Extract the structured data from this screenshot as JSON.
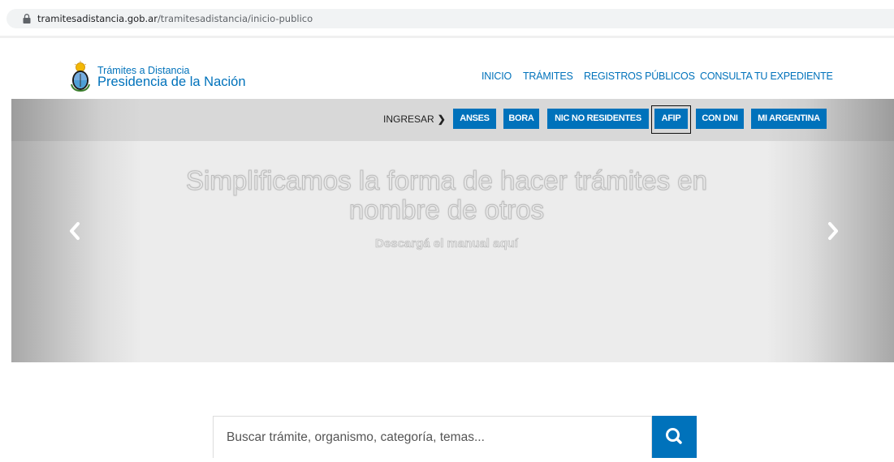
{
  "browser": {
    "url_host": "tramitesadistancia.gob.ar",
    "url_path": "/tramitesadistancia/inicio-publico",
    "lock_icon": "lock-icon"
  },
  "header": {
    "brand_line1": "Trámites a Distancia",
    "brand_line2": "Presidencia de la Nación",
    "logo_icon": "argentina-coat-of-arms-icon",
    "nav": [
      "INICIO",
      "TRÁMITES",
      "REGISTROS PÚBLICOS",
      "CONSULTA TU EXPEDIENTE"
    ]
  },
  "login": {
    "label": "INGRESAR",
    "chevron": "❯",
    "options": [
      "ANSES",
      "BORA",
      "NIC NO RESIDENTES",
      "AFIP",
      "CON DNI",
      "MI ARGENTINA"
    ],
    "highlighted": "AFIP"
  },
  "hero": {
    "title": "Simplificamos la forma de hacer trámites en nombre de otros",
    "subtitle": "Descargá el manual aquí",
    "prev_icon": "chevron-left-icon",
    "next_icon": "chevron-right-icon"
  },
  "search": {
    "placeholder": "Buscar trámite, organismo, categoría, temas...",
    "button_icon": "search-icon"
  },
  "colors": {
    "brand_blue": "#0072bb",
    "hero_gray": "#ececec"
  }
}
